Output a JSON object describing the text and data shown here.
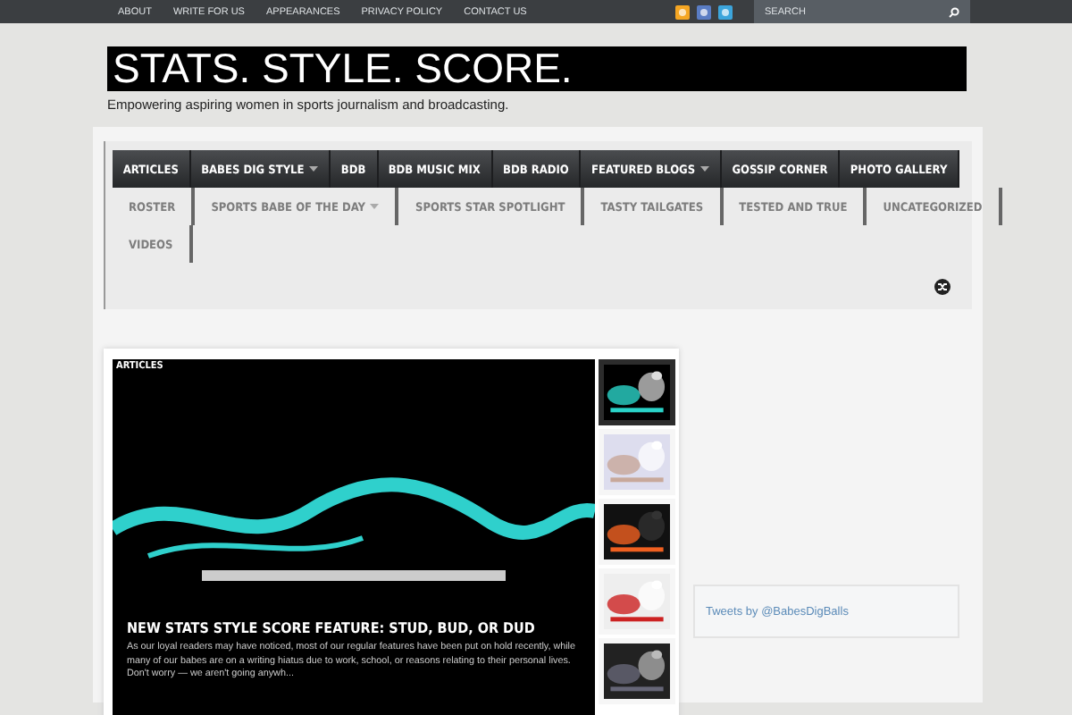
{
  "top_bar": {
    "links": [
      "ABOUT",
      "WRITE FOR US",
      "APPEARANCES",
      "PRIVACY POLICY",
      "CONTACT US"
    ],
    "search": {
      "placeholder": "SEARCH"
    }
  },
  "header": {
    "title": "STATS. STYLE. SCORE.",
    "tagline": "Empowering aspiring women in sports journalism and broadcasting."
  },
  "nav": {
    "rows": [
      {
        "kind": "bar",
        "items": [
          {
            "label": "ARTICLES",
            "has_submenu": false
          },
          {
            "label": "BABES DIG STYLE",
            "has_submenu": true
          },
          {
            "label": "BDB",
            "has_submenu": false
          },
          {
            "label": "BDB MUSIC MIX",
            "has_submenu": false
          },
          {
            "label": "BDB RADIO",
            "has_submenu": false
          },
          {
            "label": "FEATURED BLOGS",
            "has_submenu": true
          },
          {
            "label": "GOSSIP CORNER",
            "has_submenu": false
          },
          {
            "label": "PHOTO GALLERY",
            "has_submenu": false
          }
        ]
      },
      {
        "kind": "plain",
        "items": [
          {
            "label": "ROSTER",
            "has_submenu": false
          },
          {
            "label": "SPORTS BABE OF THE DAY",
            "has_submenu": true
          },
          {
            "label": "SPORTS STAR SPOTLIGHT",
            "has_submenu": false
          },
          {
            "label": "TASTY TAILGATES",
            "has_submenu": false
          },
          {
            "label": "TESTED AND TRUE",
            "has_submenu": false
          },
          {
            "label": "UNCATEGORIZED",
            "has_submenu": false
          }
        ]
      },
      {
        "kind": "plain",
        "items": [
          {
            "label": "VIDEOS",
            "has_submenu": false
          }
        ]
      }
    ]
  },
  "slider": {
    "category": "ARTICLES",
    "headline": "NEW STATS STYLE SCORE FEATURE: STUD, BUD, OR DUD",
    "excerpt": "As our loyal readers may have noticed, most of our regular features have been put on hold recently, while many of our babes are on a writing hiatus due to work, school, or reasons relating to their personal lives. Don't worry — we aren't going anywh...",
    "thumbnails": [
      {
        "selected": true
      },
      {
        "selected": false
      },
      {
        "selected": false
      },
      {
        "selected": false
      },
      {
        "selected": false
      }
    ]
  },
  "twitter": {
    "link": "Tweets by @BabesDigBalls"
  }
}
